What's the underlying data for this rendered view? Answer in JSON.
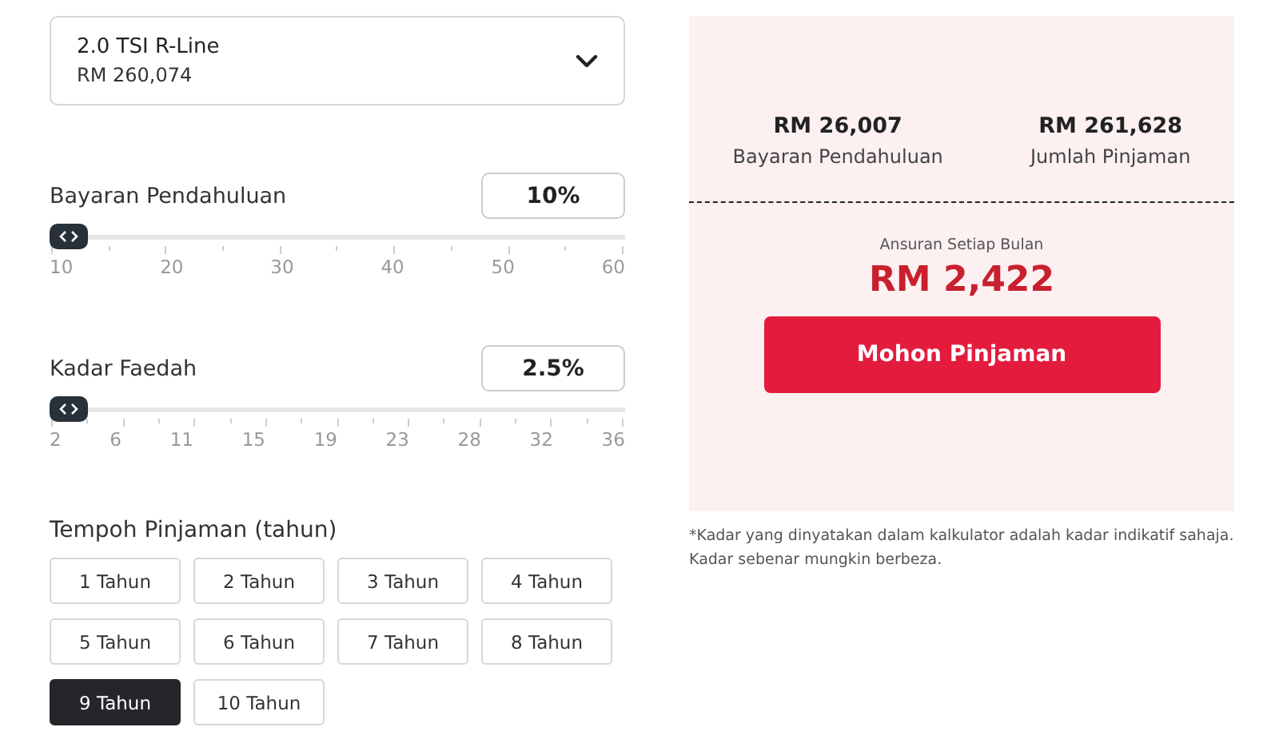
{
  "variant_select": {
    "name": "2.0 TSI R-Line",
    "price": "RM 260,074"
  },
  "sliders": [
    {
      "label": "Bayaran Pendahuluan",
      "value": "10%",
      "level": 0,
      "ticks": [
        "10",
        "20",
        "30",
        "40",
        "50",
        "60"
      ]
    },
    {
      "label": "Kadar Faedah",
      "value": "2.5%",
      "level": 0,
      "ticks": [
        "2",
        "6",
        "11",
        "15",
        "19",
        "23",
        "28",
        "32",
        "36"
      ]
    }
  ],
  "tenure": {
    "label": "Tempoh Pinjaman (tahun)",
    "options": [
      {
        "label": "1 Tahun",
        "selected": false
      },
      {
        "label": "2 Tahun",
        "selected": false
      },
      {
        "label": "3 Tahun",
        "selected": false
      },
      {
        "label": "4 Tahun",
        "selected": false
      },
      {
        "label": "5 Tahun",
        "selected": false
      },
      {
        "label": "6 Tahun",
        "selected": false
      },
      {
        "label": "7 Tahun",
        "selected": false
      },
      {
        "label": "8 Tahun",
        "selected": false
      },
      {
        "label": "9 Tahun",
        "selected": true
      },
      {
        "label": "10 Tahun",
        "selected": false
      }
    ]
  },
  "summary": {
    "stats": [
      {
        "value": "RM 26,007",
        "label": "Bayaran Pendahuluan"
      },
      {
        "value": "RM 261,628",
        "label": "Jumlah Pinjaman"
      }
    ],
    "monthly_label": "Ansuran Setiap Bulan",
    "monthly_value": "RM 2,422",
    "button": "Mohon Pinjaman"
  },
  "disclaimer": "*Kadar yang dinyatakan dalam kalkulator adalah kadar indikatif sahaja. Kadar sebenar mungkin berbeza."
}
